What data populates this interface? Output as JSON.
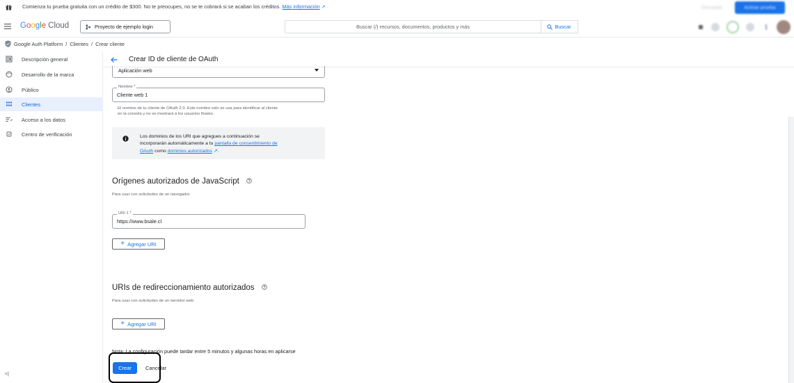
{
  "promo": {
    "text": "Comienza tu prueba gratuita con un crédito de $300. No te preocupes, no se te cobrará si se acaban los créditos.",
    "link": "Más información",
    "dismiss_label": "Descartar",
    "activate_label": "Activar prueba"
  },
  "header": {
    "logo_letters": [
      "G",
      "o",
      "o",
      "g",
      "l",
      "e"
    ],
    "logo_product": "Cloud",
    "project": "Proyecto de ejemplo login",
    "search_placeholder": "Buscar (/) recursos, documentos, productos y más",
    "search_button": "Buscar"
  },
  "breadcrumb": {
    "items": [
      "Google Auth Platform",
      "Clientes",
      "Crear cliente"
    ],
    "separator": "/"
  },
  "sidebar": {
    "items": [
      {
        "label": "Descripción general",
        "icon": "dashboard-icon"
      },
      {
        "label": "Desarrollo de la marca",
        "icon": "palette-icon"
      },
      {
        "label": "Público",
        "icon": "person-icon"
      },
      {
        "label": "Clientes",
        "icon": "grid-icon",
        "active": true
      },
      {
        "label": "Acceso a los datos",
        "icon": "filter-list-icon"
      },
      {
        "label": "Centro de verificación",
        "icon": "verified-box-icon"
      }
    ],
    "collapse_label": "<|"
  },
  "page": {
    "title": "Crear ID de cliente de OAuth"
  },
  "form": {
    "app_type": "Aplicación web",
    "name_label": "Nombre *",
    "name_value": "Cliente web 1",
    "name_help_1": "El nombre de tu cliente de OAuth 2.0. Este nombre solo se usa para identificar al cliente",
    "name_help_2": "en la consola y no se mostrará a los usuarios finales.",
    "info_line_1": "Los dominios de los URI que agregues a continuación se",
    "info_line_2_pre": "incorporarán automáticamente a tu ",
    "info_link_1": "pantalla de consentimiento de",
    "info_link_1b": "OAuth",
    "info_mid": " como ",
    "info_link_2": "dominios autorizados",
    "info_end": ".",
    "js_title": "Orígenes autorizados de JavaScript",
    "js_help": "Para usar con solicitudes de un navegador",
    "uri_label": "URI 1 *",
    "uri_value": "https://www.bsale.cl",
    "add_uri": "Agregar URI",
    "redirect_title": "URIs de redireccionamiento autorizados",
    "redirect_help": "Para usar con solicitudes de un servidor web",
    "add_uri_2": "Agregar URI",
    "note": "Nota: La configuración puede tardar entre 5 minutos y algunas horas en aplicarse",
    "create": "Crear",
    "cancel": "Cancelar"
  },
  "colors": {
    "accent": "#1a73e8",
    "active_bg": "#e8f0fe",
    "highlight": "#000000"
  }
}
